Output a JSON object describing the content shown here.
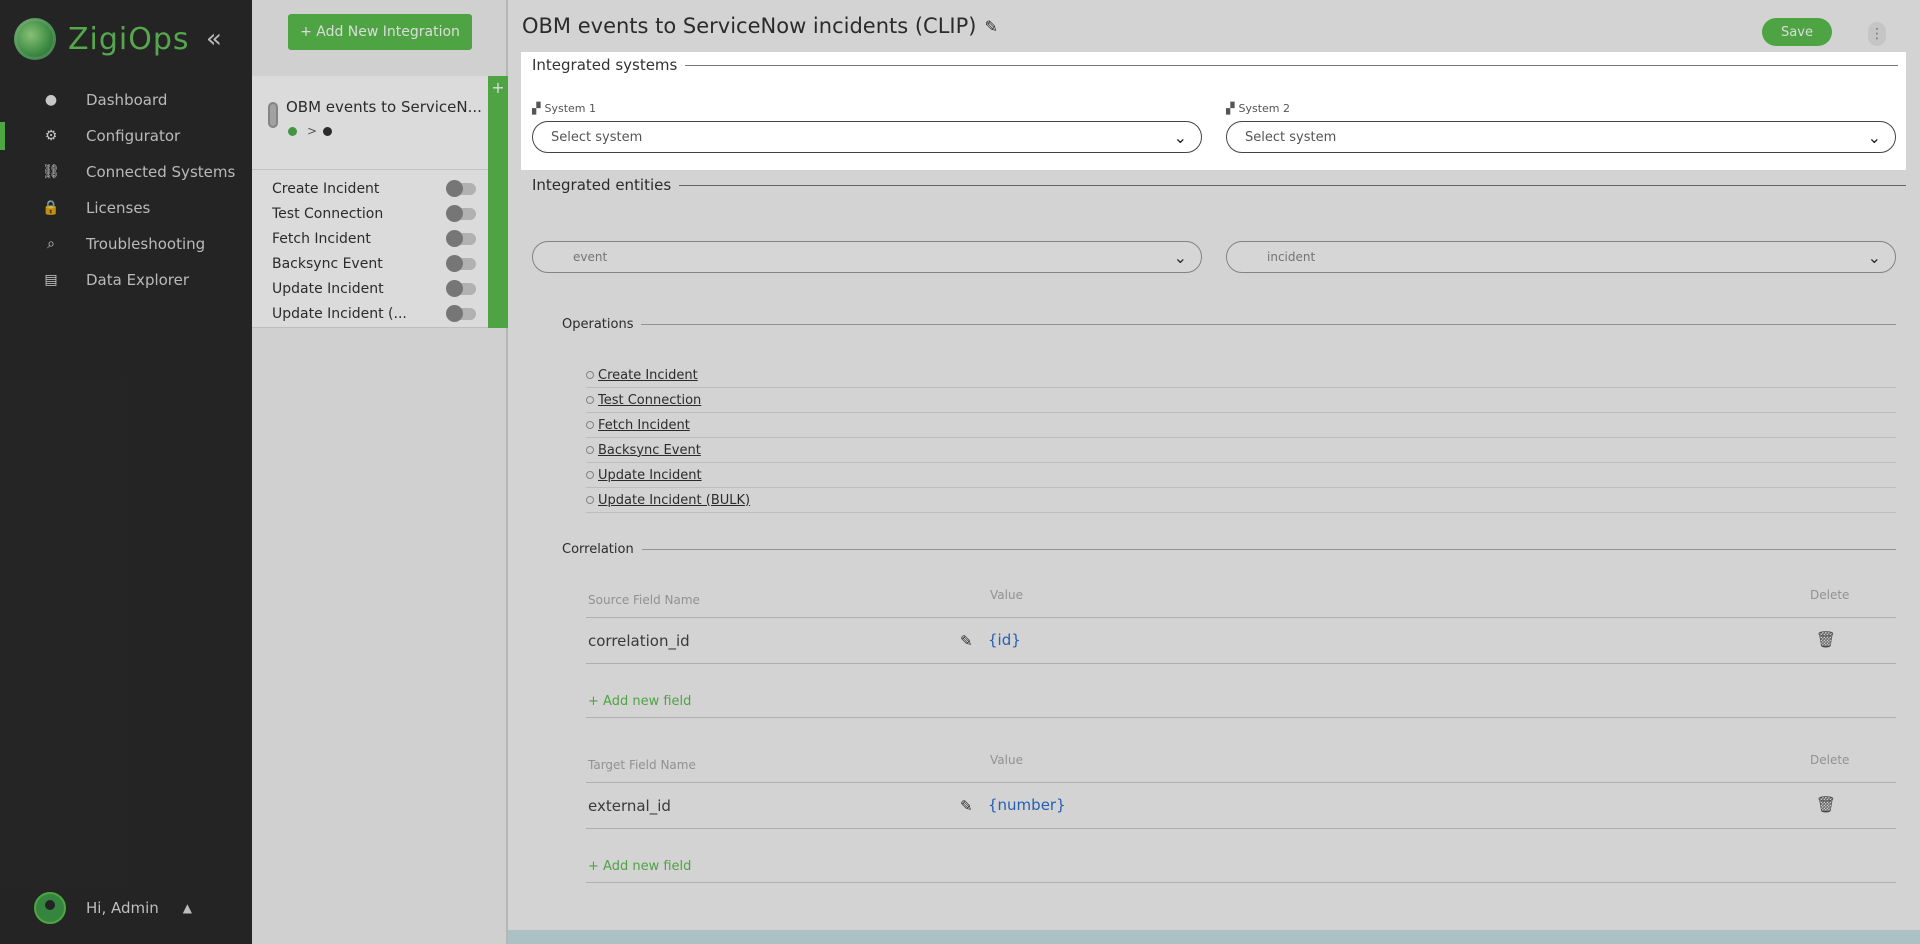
{
  "app": {
    "logo_text": "ZigiOps",
    "collapse_icon": "double-chevron-left-icon"
  },
  "sidebar": {
    "items": [
      {
        "label": "Dashboard",
        "icon": "dashboard-icon",
        "glyph": "●"
      },
      {
        "label": "Configurator",
        "icon": "gear-icon",
        "glyph": "⚙"
      },
      {
        "label": "Connected Systems",
        "icon": "network-icon",
        "glyph": "⛓"
      },
      {
        "label": "Licenses",
        "icon": "lock-icon",
        "glyph": "🔒"
      },
      {
        "label": "Troubleshooting",
        "icon": "search-icon",
        "glyph": "⌕"
      },
      {
        "label": "Data Explorer",
        "icon": "data-explorer-icon",
        "glyph": "▤"
      }
    ],
    "user": {
      "greeting": "Hi, Admin",
      "caret": "▲"
    }
  },
  "integrations": {
    "add_label": "+ Add New Integration",
    "card": {
      "title": "OBM events to ServiceN...",
      "status_arrow": ">",
      "plus": "+",
      "operations": [
        "Create Incident",
        "Test Connection",
        "Fetch Incident",
        "Backsync Event",
        "Update Incident",
        "Update Incident (..."
      ]
    }
  },
  "main": {
    "title": "OBM events to ServiceNow incidents (CLIP)",
    "edit_icon": "✎",
    "save_label": "Save",
    "kebab": "⋮",
    "integrated_systems": {
      "legend": "Integrated systems",
      "system1_label": "System 1",
      "system2_label": "System 2",
      "system1_placeholder": "Select system",
      "system2_placeholder": "Select system",
      "chevron": "⌄"
    },
    "integrated_entities": {
      "legend": "Integrated entities",
      "entity1": "event",
      "entity2": "incident"
    },
    "operations": {
      "legend": "Operations",
      "items": [
        "Create Incident",
        "Test Connection",
        "Fetch Incident",
        "Backsync Event",
        "Update Incident",
        "Update Incident (BULK)"
      ]
    },
    "correlation": {
      "legend": "Correlation",
      "source_header": "Source Field Name",
      "value_header": "Value",
      "delete_header": "Delete",
      "source_row": {
        "field": "correlation_id",
        "value": "{id}"
      },
      "add_field": "+ Add new field",
      "target_header": "Target Field Name",
      "target_row": {
        "field": "external_id",
        "value": "{number}"
      }
    }
  },
  "colors": {
    "brand_green": "#5bbf4f",
    "sidebar_bg": "#2b2b2b",
    "link_blue": "#2a6fd1"
  }
}
